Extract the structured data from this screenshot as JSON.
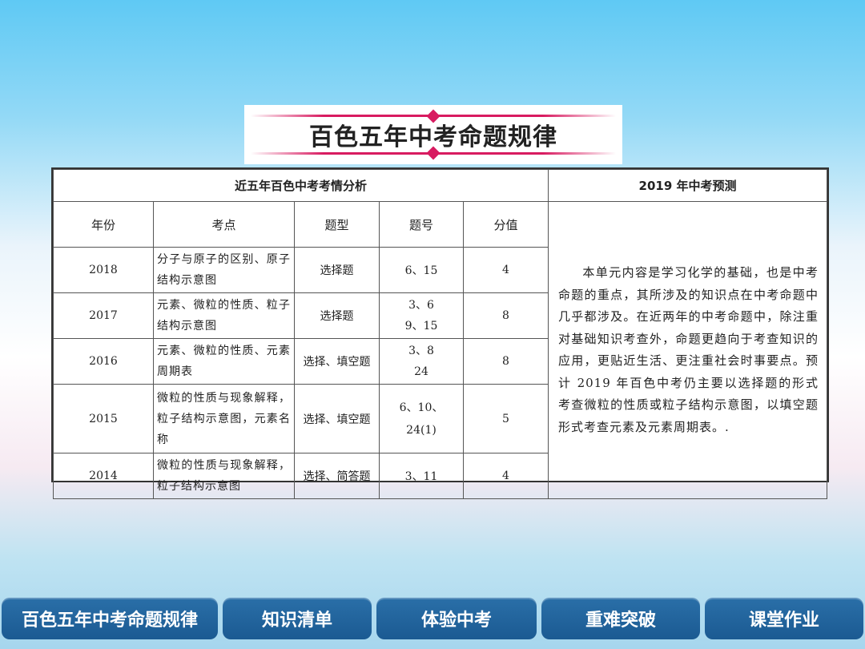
{
  "title": "百色五年中考命题规律",
  "table": {
    "analysis_header": "近五年百色中考考情分析",
    "prediction_header": "2019 年中考预测",
    "columns": [
      "年份",
      "考点",
      "题型",
      "题号",
      "分值"
    ],
    "rows": [
      {
        "year": "2018",
        "topic": "分子与原子的区别、原子结构示意图",
        "type": "选择题",
        "num_line1": "6、15",
        "num_line2": "",
        "score": "4"
      },
      {
        "year": "2017",
        "topic": "元素、微粒的性质、粒子结构示意图",
        "type": "选择题",
        "num_line1": "3、6",
        "num_line2": "9、15",
        "score": "8"
      },
      {
        "year": "2016",
        "topic": "元素、微粒的性质、元素周期表",
        "type": "选择、填空题",
        "num_line1": "3、8",
        "num_line2": "24",
        "score": "8"
      },
      {
        "year": "2015",
        "topic": "微粒的性质与现象解释，粒子结构示意图，元素名称",
        "type": "选择、填空题",
        "num_line1": "6、10、",
        "num_line2": "24(1)",
        "score": "5"
      },
      {
        "year": "2014",
        "topic": "微粒的性质与现象解释，粒子结构示意图",
        "type": "选择、简答题",
        "num_line1": "3、11",
        "num_line2": "",
        "score": "4"
      }
    ],
    "prediction_text": "本单元内容是学习化学的基础，也是中考命题的重点，其所涉及的知识点在中考命题中几乎都涉及。在近两年的中考命题中，除注重对基础知识考查外，命题更趋向于考查知识的应用，更贴近生活、更注重社会时事要点。预计 2019 年百色中考仍主要以选择题的形式考查微粒的性质或粒子结构示意图，以填空题形式考查元素及元素周期表。."
  },
  "nav": [
    "百色五年中考命题规律",
    "知识清单",
    "体验中考",
    "重难突破",
    "课堂作业"
  ]
}
